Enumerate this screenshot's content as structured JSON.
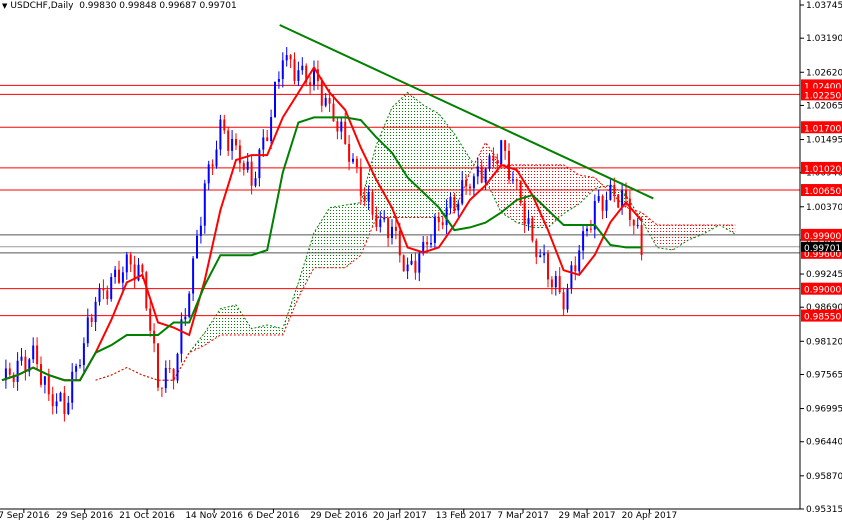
{
  "header": {
    "symbol": "USDCHF,Daily",
    "ohlc": "0.99830 0.99848 0.99687 0.99701"
  },
  "chart_data": {
    "type": "candlestick",
    "title": "USDCHF,Daily",
    "ylim": [
      0.95315,
      1.03745
    ],
    "y_ticks": [
      "1.03745",
      "1.03190",
      "1.02620",
      "1.02065",
      "1.01495",
      "1.00940",
      "1.00370",
      "0.99815",
      "0.99245",
      "0.98690",
      "0.98120",
      "0.97565",
      "0.96995",
      "0.96440",
      "0.95870",
      "0.95315"
    ],
    "x_ticks": [
      {
        "label": "7 Sep 2016",
        "index": 1.4
      },
      {
        "label": "29 Sep 2016",
        "index": 5.3
      },
      {
        "label": "21 Oct 2016",
        "index": 9.3
      },
      {
        "label": "14 Nov 2016",
        "index": 13.6
      },
      {
        "label": "6 Dec 2016",
        "index": 17.4
      },
      {
        "label": "29 Dec 2016",
        "index": 21.6
      },
      {
        "label": "20 Jan 2017",
        "index": 25.5
      },
      {
        "label": "13 Feb 2017",
        "index": 29.6
      },
      {
        "label": "7 Mar 2017",
        "index": 33.4
      },
      {
        "label": "29 Mar 2017",
        "index": 37.5
      },
      {
        "label": "20 Apr 2017",
        "index": 41.5
      }
    ],
    "closes": [
      0.9747,
      0.9764,
      0.9789,
      0.9722,
      0.9705,
      0.9789,
      0.9881,
      0.9906,
      0.994,
      0.9923,
      0.9747,
      0.9764,
      0.9898,
      1.0065,
      1.0165,
      1.0132,
      1.0082,
      1.0165,
      1.0291,
      1.0257,
      1.0249,
      1.0199,
      1.0149,
      1.0073,
      1.0015,
      0.9998,
      0.9923,
      0.9965,
      1.0015,
      1.0048,
      1.0082,
      1.0098,
      1.0132,
      1.0065,
      0.9981,
      0.9931,
      0.9881,
      0.9965,
      1.0032,
      1.0057,
      1.0048,
      0.99701
    ],
    "current_price": "0.99701",
    "levels": [
      {
        "label": "1.02400",
        "price": 1.024,
        "line": "#ff0000"
      },
      {
        "label": "1.02250",
        "price": 1.0225,
        "line": "#ff0000"
      },
      {
        "label": "1.01700",
        "price": 1.017,
        "line": "#ff0000"
      },
      {
        "label": "1.01020",
        "price": 1.0102,
        "line": "#ff0000"
      },
      {
        "label": "1.00650",
        "price": 1.0065,
        "line": "#ff0000"
      },
      {
        "label": "0.99900",
        "price": 0.999,
        "line": "#555555"
      },
      {
        "label": "0.99600",
        "price": 0.996,
        "line": "#555555"
      },
      {
        "label": "0.99000",
        "price": 0.99,
        "line": "#ff0000"
      },
      {
        "label": "0.98550",
        "price": 0.9855,
        "line": "#ff0000"
      }
    ],
    "trendline": {
      "from": {
        "index": 17.8,
        "price": 1.0341
      },
      "to": {
        "index": 41.75,
        "price": 1.0051
      }
    },
    "colors": {
      "bull": "#0000ff",
      "bear": "#ff0000",
      "tenkan": "#ff0000",
      "kijun": "#008000",
      "cloud_up": "#008000",
      "cloud_down": "#ff0000",
      "trend": "#008000",
      "level_label": "#ff0000"
    }
  }
}
